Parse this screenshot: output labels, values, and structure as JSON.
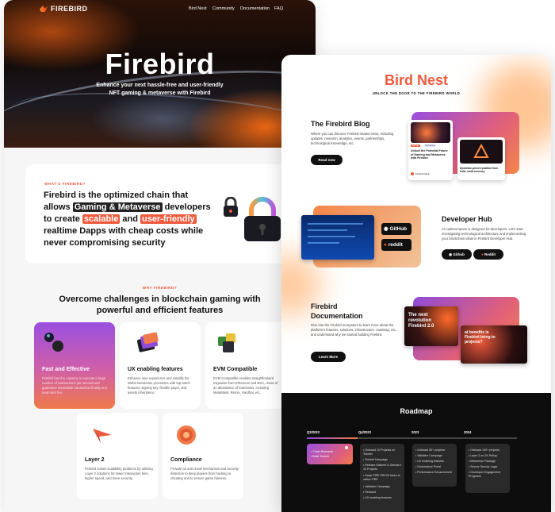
{
  "header": {
    "brand": "FIREBIRD",
    "nav": [
      "Bird Nest",
      "Community",
      "Documentation",
      "FAQ"
    ]
  },
  "hero": {
    "title": "Firebird",
    "subtitle_line1": "Enhance your next hassle-free and user-friendly",
    "subtitle_line2": "NFT gaming & metaverse with Firebird"
  },
  "what": {
    "label": "WHAT'S FIREBIRD?",
    "t1": "Firebird is the optimized chain that",
    "t2a": "allows ",
    "t2b": "Gaming & Metaverse",
    "t2c": " developers",
    "t3a": "to create ",
    "t3b": "scalable",
    "t3c": " and ",
    "t3d": "user-friendly",
    "t4": "realtime Dapps with cheap costs while",
    "t5": "never compromising security"
  },
  "why": {
    "label": "WHY FIREBIRD?",
    "title1": "Overcome challenges in blockchain gaming with",
    "title2": "powerful and efficient features"
  },
  "features": [
    {
      "title": "Fast and Effective",
      "desc": "Firebird has the capacity to execute a huge number of transactions per second and guarantee immediate transaction finality at a near-zero fee."
    },
    {
      "title": "UX enabling features",
      "desc": "Enhance user experience and simplify the Web3 interaction processes with top-notch features: signing key, flexible payer, and assets inheritance."
    },
    {
      "title": "EVM Compatible",
      "desc": "EVM Compatible enables straightforward migration from Ethereum and BSC, reuse of an abundance of toolchains, including MetaMask, Remix, Hardhat, etc."
    },
    {
      "title": "Layer 2",
      "desc": "Firebird solves scalability problems by utilizing Layer 2 solutions for lower transaction fees, higher speed, and more security."
    },
    {
      "title": "Compliance",
      "desc": "Provide an anti-cheat mechanism and security detection to keep players from hacking or cheating and to ensure game fairness."
    }
  ],
  "birdnest": {
    "title": "Bird Nest",
    "subtitle": "UNLOCK THE DOOR TO THE FIREBIRD WORLD"
  },
  "blog": {
    "title": "The Firebird Blog",
    "desc": "Where you can discover Firebird-related news, including updates, research, analytics, events, partnerships, technological knowledge, etc.",
    "button": "Read now",
    "card_title": "Unlock the Potential Future of Gaming and Metaverse with Firebird",
    "card_tag1": "Highlight",
    "card_tag2": "Technology",
    "card2_title": "Dynastice-proven position from Indie, multi-currency",
    "card_author": "Firebird Admin"
  },
  "devhub": {
    "title": "Developer Hub",
    "desc": "An optimal space is designed for developers. Let's start investigating technological architecture and implementing your blockchain ideas in Firebird Developer Hub.",
    "btn_github": "Github",
    "btn_reddit": "Reddit",
    "logo_github": "GitHub",
    "logo_reddit": "reddit"
  },
  "docs": {
    "title1": "Firebird",
    "title2": "Documentation",
    "desc": "Dive into the Firebird ecosystem to learn more about the platform's features, solutions, infrastructure, roadmap, etc., and understand why we started building Firebird.",
    "button": "Learn More",
    "img1": "The next revolution Firebird 2.0",
    "img2": "at benefits is Firebird bring to projects?"
  },
  "roadmap": {
    "title": "Roadmap",
    "periods": [
      {
        "label": "Q3/2022",
        "items": [
          "Chain Research",
          "Build Testnet"
        ]
      },
      {
        "label": "Q4/2022",
        "items": [
          "Onboard 10 Projects on Testnet",
          "Testnet Campaign",
          "Release Mainnet & Onboard 10 Projects",
          "Swap FIRE ERC20 token to native FIRE",
          "Validator Campaign",
          "Rebrand",
          "UX enabling features"
        ]
      },
      {
        "label": "2023",
        "items": [
          "Onboard 50+ projects",
          "Validator Campaign",
          "UX enabling features",
          "Governance Portal",
          "Performance Enhancement"
        ]
      },
      {
        "label": "2024",
        "items": [
          "Onboard 100+ projects",
          "Layer 2 on ZK Rollup",
          "Metaverse Package",
          "Secure Service Layer",
          "Developer Engagement Programs"
        ]
      }
    ]
  },
  "colors": {
    "accent": "#f05a3c",
    "brand_orange": "#ff7a1a",
    "purple": "#8f4bd8"
  }
}
